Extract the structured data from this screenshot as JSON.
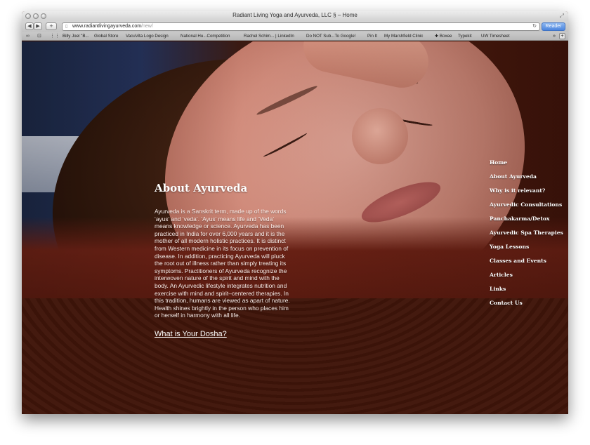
{
  "browser": {
    "window_title": "Radiant Living Yoga and Ayurveda, LLC § – Home",
    "url_main": "www.radiantlivingayurveda.com",
    "url_path": "/new/",
    "reader_label": "Reader",
    "back_icon": "◀",
    "forward_icon": "▶",
    "add_tab_icon": "+",
    "bookmarks": [
      "Billy Joel \"B...",
      "Global Store",
      "VacuVita Logo Design",
      "National Hu...Competition",
      "Rachel Schim... | LinkedIn",
      "Do NOT Sub...To Google!",
      "Pin It",
      "My Marshfield Clinic",
      "✚ Boxee",
      "Typekit",
      "UW Timesheet"
    ],
    "bookmarks_more": "»"
  },
  "main": {
    "heading": "About Ayurveda",
    "body": "Ayurveda is a Sanskrit term, made up of the words ‘ayus’ and ‘veda’. ‘Ayus’ means life and ‘Veda’ means knowledge or science. Ayurveda has been practiced in India for over 6,000 years and it is the mother of all modern holistic practices. It is distinct from Western medicine in its focus on prevention of disease. In addition, practicing Ayurveda will pluck the root out of illness rather than simply treating its symptoms. Practitioners of Ayurveda recognize the interwoven nature of the spirit and mind with the body. An Ayurvedic lifestyle integrates nutrition and exercise with mind and spirit–centered therapies. In this tradition, humans are viewed as apart of nature. Health shines brightly in the person who places him or herself in harmony with all life.",
    "dosha_link": "What is Your Dosha?"
  },
  "nav": {
    "items": [
      "Home",
      "About Ayurveda",
      "Why is it relevant?",
      "Ayurvedic Consultations",
      "Panchakarma/Detox",
      "Ayurvedic Spa Therapies",
      "Yoga Lessons",
      "Classes and Events",
      "Articles",
      "Links",
      "Contact Us"
    ]
  },
  "colors": {
    "page_background": "#40150a",
    "text": "#ffffff",
    "reader_button": "#4d86de"
  }
}
